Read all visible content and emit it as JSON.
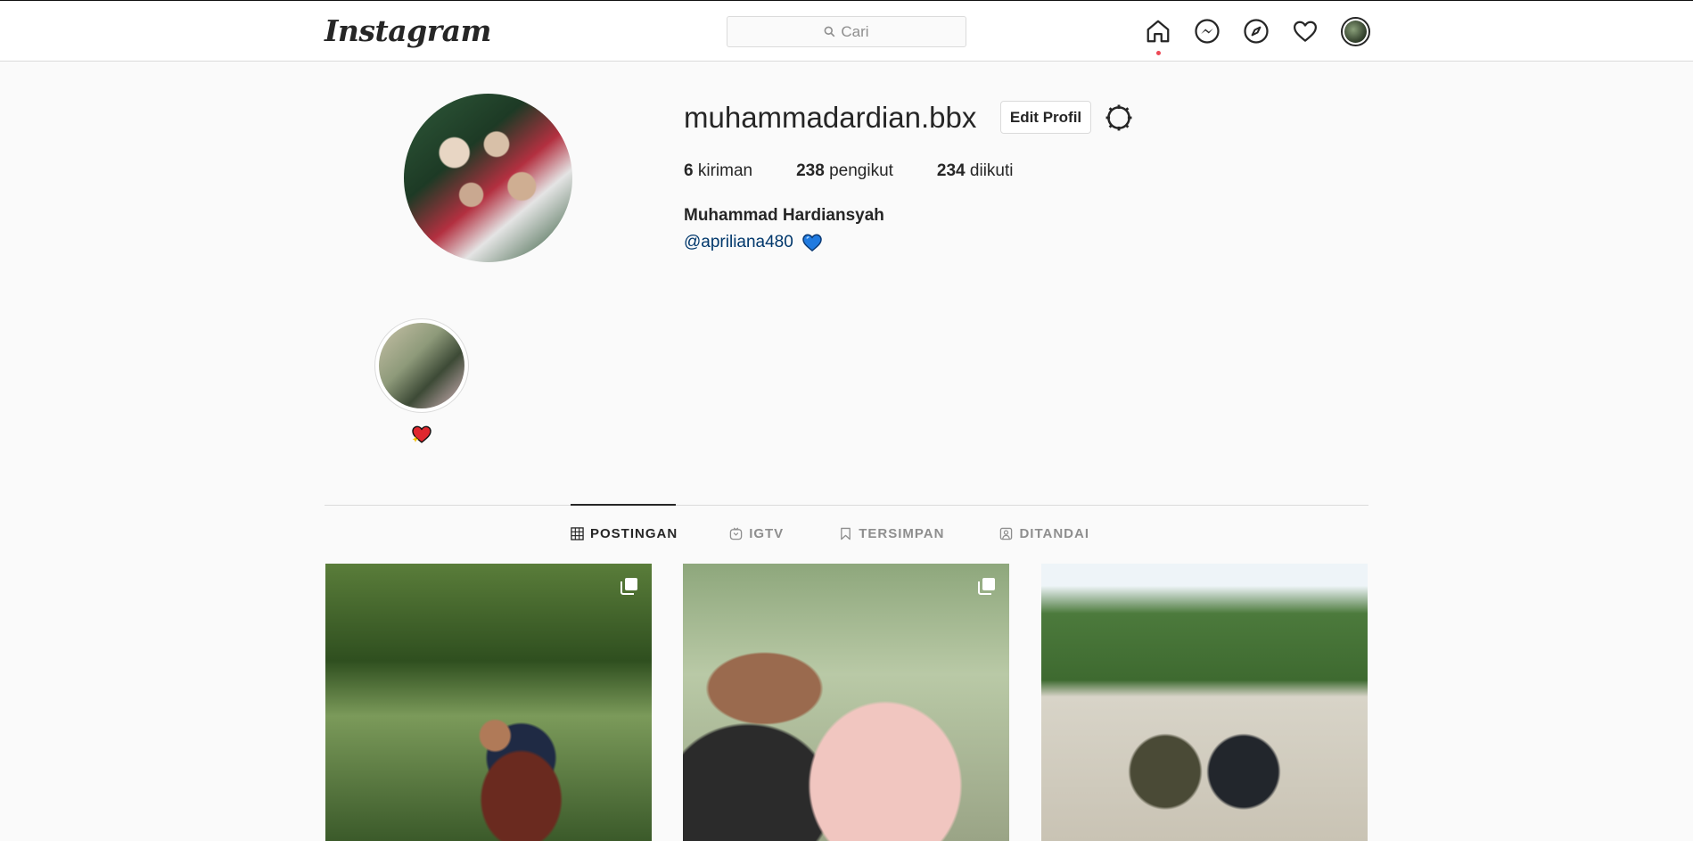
{
  "app": {
    "logo_text": "Instagram"
  },
  "search": {
    "placeholder": "Cari"
  },
  "nav": {
    "icons": [
      "home-icon",
      "messenger-icon",
      "explore-icon",
      "heart-icon",
      "avatar"
    ],
    "notification_color": "#ed4956"
  },
  "profile": {
    "username": "muhammadardian.bbx",
    "edit_label": "Edit Profil",
    "stats": {
      "posts_count": "6",
      "posts_label": "kiriman",
      "followers_count": "238",
      "followers_label": "pengikut",
      "following_count": "234",
      "following_label": "diikuti"
    },
    "full_name": "Muhammad Hardiansyah",
    "bio_mention": "@apriliana480",
    "bio_emoji": "blue-heart-icon"
  },
  "highlights": [
    {
      "label_icon": "red-heart-sparkle-icon"
    }
  ],
  "tabs": [
    {
      "label": "POSTINGAN",
      "icon": "grid-icon",
      "active": true
    },
    {
      "label": "IGTV",
      "icon": "igtv-icon",
      "active": false
    },
    {
      "label": "TERSIMPAN",
      "icon": "bookmark-icon",
      "active": false
    },
    {
      "label": "DITANDAI",
      "icon": "tagged-icon",
      "active": false
    }
  ],
  "posts": [
    {
      "multiple": true
    },
    {
      "multiple": true
    },
    {
      "multiple": false
    }
  ],
  "colors": {
    "link": "#00376b",
    "border": "#dbdbdb",
    "background": "#fafafa"
  }
}
